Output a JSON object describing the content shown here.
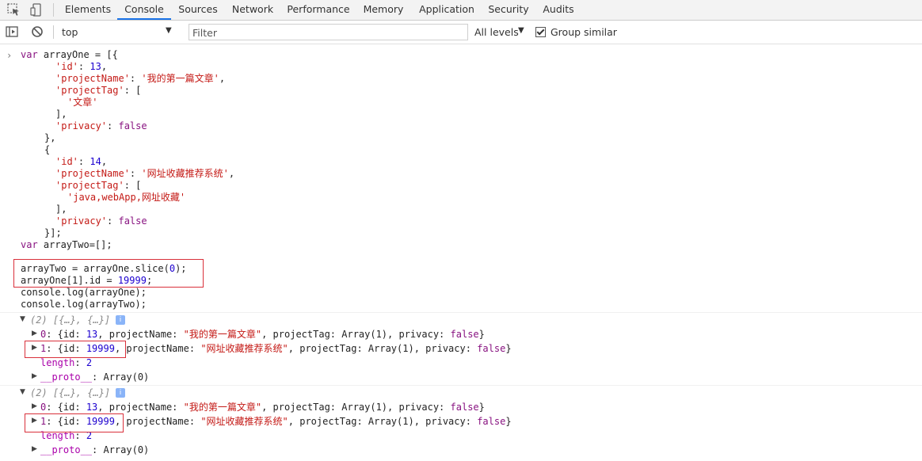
{
  "tabs": [
    "Elements",
    "Console",
    "Sources",
    "Network",
    "Performance",
    "Memory",
    "Application",
    "Security",
    "Audits"
  ],
  "active_tab": "Console",
  "toolbar": {
    "context": "top",
    "filter_placeholder": "Filter",
    "levels": "All levels",
    "group_similar": "Group similar"
  },
  "code_lines": [
    {
      "parts": [
        [
          "kw",
          "var "
        ],
        [
          "plain",
          "arrayOne = [{"
        ]
      ]
    },
    {
      "parts": [
        [
          "str",
          "'id'"
        ],
        [
          "plain",
          ": "
        ],
        [
          "num",
          "13"
        ],
        [
          "plain",
          ","
        ]
      ]
    },
    {
      "parts": [
        [
          "str",
          "'projectName'"
        ],
        [
          "plain",
          ": "
        ],
        [
          "str",
          "'我的第一篇文章'"
        ],
        [
          "plain",
          ","
        ]
      ]
    },
    {
      "parts": [
        [
          "str",
          "'projectTag'"
        ],
        [
          "plain",
          ": ["
        ]
      ]
    },
    {
      "parts": [
        [
          "str",
          "'文章'"
        ]
      ]
    },
    {
      "parts": [
        [
          "plain",
          "],"
        ]
      ]
    },
    {
      "parts": [
        [
          "str",
          "'privacy'"
        ],
        [
          "plain",
          ": "
        ],
        [
          "kw",
          "false"
        ]
      ]
    },
    {
      "parts": [
        [
          "plain",
          "},"
        ]
      ]
    },
    {
      "parts": [
        [
          "plain",
          "{"
        ]
      ]
    },
    {
      "parts": [
        [
          "str",
          "'id'"
        ],
        [
          "plain",
          ": "
        ],
        [
          "num",
          "14"
        ],
        [
          "plain",
          ","
        ]
      ]
    },
    {
      "parts": [
        [
          "str",
          "'projectName'"
        ],
        [
          "plain",
          ": "
        ],
        [
          "str",
          "'网址收藏推荐系统'"
        ],
        [
          "plain",
          ","
        ]
      ]
    },
    {
      "parts": [
        [
          "str",
          "'projectTag'"
        ],
        [
          "plain",
          ": ["
        ]
      ]
    },
    {
      "parts": [
        [
          "str",
          "'java,webApp,网址收藏'"
        ]
      ]
    },
    {
      "parts": [
        [
          "plain",
          "],"
        ]
      ]
    },
    {
      "parts": [
        [
          "str",
          "'privacy'"
        ],
        [
          "plain",
          ": "
        ],
        [
          "kw",
          "false"
        ]
      ]
    },
    {
      "parts": [
        [
          "plain",
          "}];"
        ]
      ]
    },
    {
      "parts": [
        [
          "kw",
          "var "
        ],
        [
          "plain",
          "arrayTwo=[];"
        ]
      ]
    },
    {
      "parts": [
        [
          "plain",
          ""
        ]
      ]
    },
    {
      "parts": [
        [
          "plain",
          "arrayTwo = arrayOne.slice("
        ],
        [
          "num",
          "0"
        ],
        [
          "plain",
          ");"
        ]
      ]
    },
    {
      "parts": [
        [
          "plain",
          "arrayOne[1].id = "
        ],
        [
          "num",
          "19999"
        ],
        [
          "plain",
          ";"
        ]
      ]
    },
    {
      "parts": [
        [
          "plain",
          "console.log(arrayOne);"
        ]
      ]
    },
    {
      "parts": [
        [
          "plain",
          "console.log(arrayTwo);"
        ]
      ]
    }
  ],
  "outputs": [
    {
      "summary": "(2) [{…}, {…}]",
      "items": [
        {
          "key": "0",
          "id": "13",
          "name": "\"我的第一篇文章\"",
          "rest": ", projectTag: Array(1), privacy: ",
          "bool": "false"
        },
        {
          "key": "1",
          "id": "19999",
          "name": "\"网址收藏推荐系统\"",
          "rest": ", projectTag: Array(1), privacy: ",
          "bool": "false"
        }
      ],
      "length_label": "length",
      "length_value": "2",
      "proto_label": "__proto__",
      "proto_value": "Array(0)"
    },
    {
      "summary": "(2) [{…}, {…}]",
      "items": [
        {
          "key": "0",
          "id": "13",
          "name": "\"我的第一篇文章\"",
          "rest": ", projectTag: Array(1), privacy: ",
          "bool": "false"
        },
        {
          "key": "1",
          "id": "19999",
          "name": "\"网址收藏推荐系统\"",
          "rest": ", projectTag: Array(1), privacy: ",
          "bool": "false"
        }
      ],
      "length_label": "length",
      "length_value": "2",
      "proto_label": "__proto__",
      "proto_value": "Array(0)"
    }
  ],
  "colors": {
    "highlight_box": "#d9303b",
    "active_tab_underline": "#1a73e8"
  }
}
